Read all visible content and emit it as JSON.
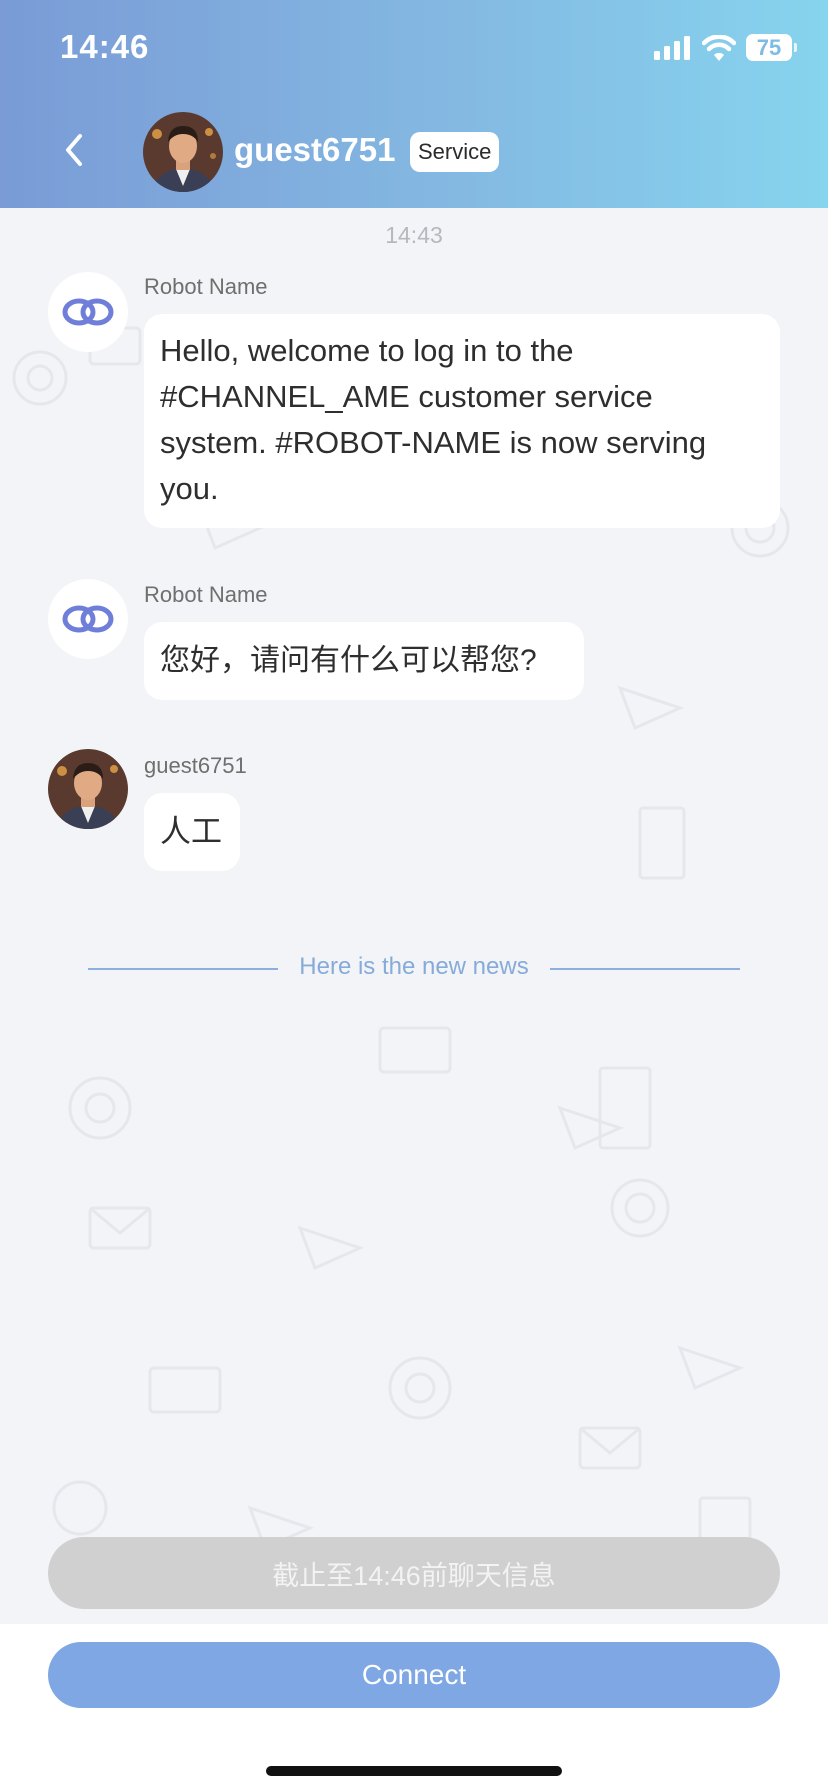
{
  "status_bar": {
    "time": "14:46",
    "battery": "75"
  },
  "header": {
    "title": "guest6751",
    "badge": "Service"
  },
  "chat": {
    "timestamp": "14:43",
    "messages": [
      {
        "sender": "Robot Name",
        "text": "Hello, welcome to log in to the #CHANNEL_AME customer service system. #ROBOT-NAME is now serving you."
      },
      {
        "sender": "Robot Name",
        "text": "您好，请问有什么可以帮您?"
      },
      {
        "sender": "guest6751",
        "text": "人工"
      }
    ],
    "divider_text": "Here is the new news"
  },
  "notice": "截止至14:46前聊天信息",
  "connect_label": "Connect",
  "colors": {
    "accent": "#7ea7e4",
    "header_start": "#7a9bd6",
    "header_end": "#86d4ee",
    "robot_icon": "#6f7ed8"
  }
}
